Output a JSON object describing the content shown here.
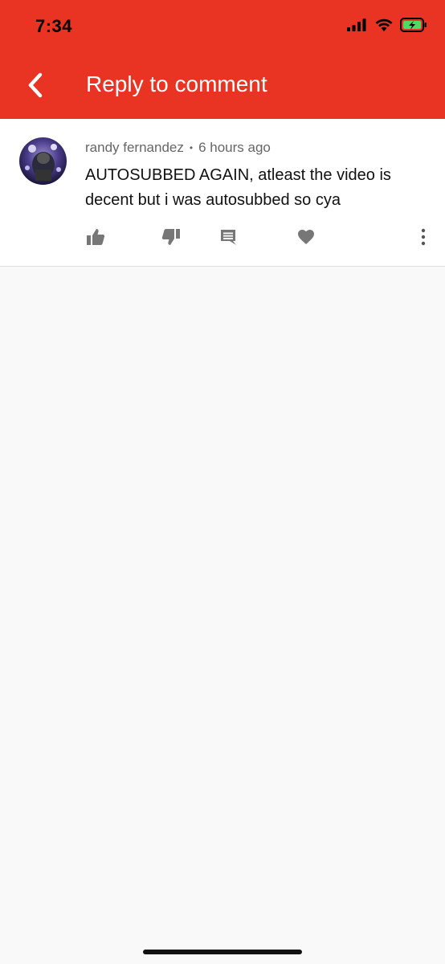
{
  "status_bar": {
    "time": "7:34"
  },
  "header": {
    "title": "Reply to comment",
    "back_icon": "chevron-left-icon",
    "background_color": "#e93323"
  },
  "comment": {
    "author": "randy fernandez",
    "separator": "•",
    "time_ago": "6 hours ago",
    "text": "AUTOSUBBED AGAIN, atleast the video is decent but i was autosubbed so cya",
    "actions": [
      {
        "icon": "thumbs-up-icon"
      },
      {
        "icon": "thumbs-down-icon"
      },
      {
        "icon": "reply-comment-icon"
      },
      {
        "icon": "heart-icon"
      },
      {
        "icon": "more-vertical-icon"
      }
    ]
  }
}
